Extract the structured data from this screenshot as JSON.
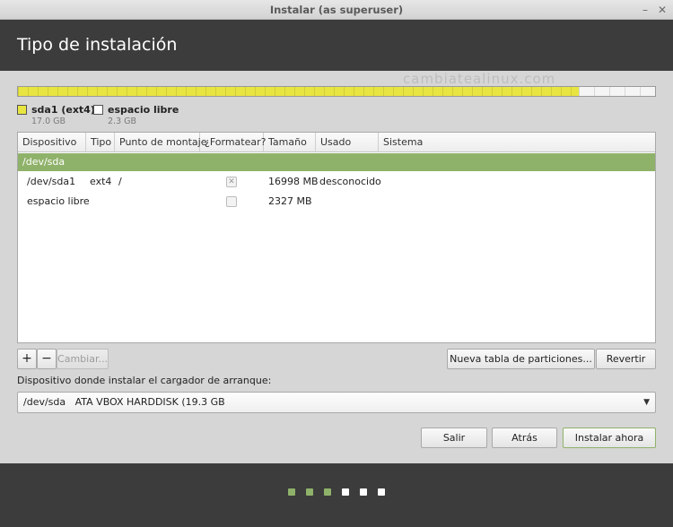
{
  "window": {
    "title": "Instalar (as superuser)",
    "minimize_glyph": "–",
    "close_glyph": "✕"
  },
  "header": {
    "title": "Tipo de instalación"
  },
  "watermark": "cambiatealinux.com",
  "partition_bar": {
    "used_fraction": 0.88,
    "used_color": "#e8e542",
    "free_color": "#f5f5f5"
  },
  "legend": [
    {
      "name": "sda1 (ext4)",
      "size": "17.0 GB",
      "color": "#e8e542"
    },
    {
      "name": "espacio libre",
      "size": "2.3 GB",
      "color": "#ffffff"
    }
  ],
  "table": {
    "columns": [
      "Dispositivo",
      "Tipo",
      "Punto de montaje",
      "¿Formatear?",
      "Tamaño",
      "Usado",
      "Sistema"
    ],
    "group": "/dev/sda",
    "rows": [
      {
        "device": "/dev/sda1",
        "type": "ext4",
        "mount": "/",
        "format": true,
        "size": "16998 MB",
        "used": "desconocido",
        "system": ""
      },
      {
        "device": "espacio libre",
        "type": "",
        "mount": "",
        "format": false,
        "size": "2327 MB",
        "used": "",
        "system": ""
      }
    ]
  },
  "partition_buttons": {
    "add": "+",
    "remove": "−",
    "change": "Cambiar...",
    "new_table": "Nueva tabla de particiones...",
    "revert": "Revertir"
  },
  "bootloader": {
    "label": "Dispositivo donde instalar el cargador de arranque:",
    "value": "/dev/sda   ATA VBOX HARDDISK (19.3 GB"
  },
  "nav_buttons": {
    "quit": "Salir",
    "back": "Atrás",
    "install": "Instalar ahora"
  },
  "progress_dots": {
    "total": 6,
    "completed": 3,
    "done_color": "#8fb26a",
    "todo_color": "#ffffff"
  }
}
